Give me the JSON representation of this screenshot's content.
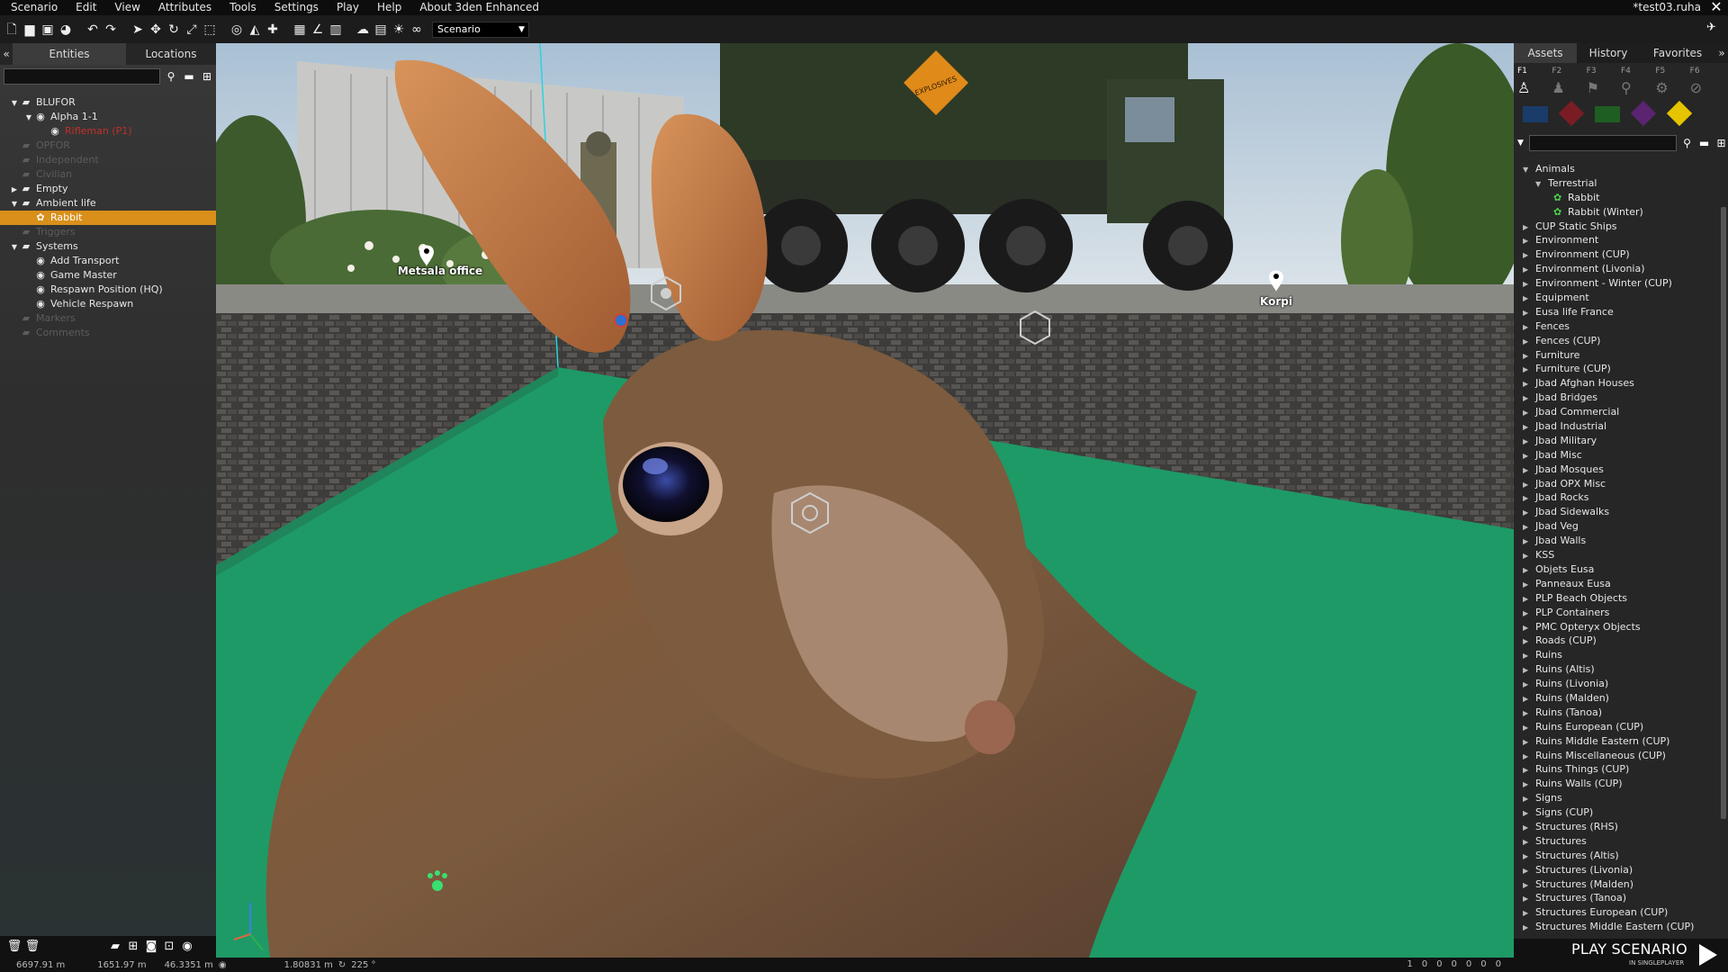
{
  "menubar": {
    "items": [
      "Scenario",
      "Edit",
      "View",
      "Attributes",
      "Tools",
      "Settings",
      "Play",
      "Help",
      "About 3den Enhanced"
    ],
    "file_name": "*test03.ruha"
  },
  "toolbar": {
    "scenario_select": "Scenario"
  },
  "left_panel": {
    "tabs": [
      "Entities",
      "Locations"
    ],
    "search_value": "",
    "tree": [
      {
        "label": "BLUFOR",
        "level": 0,
        "expanded": true,
        "dim": false
      },
      {
        "label": "Alpha 1-1",
        "level": 1,
        "expanded": true,
        "dim": false
      },
      {
        "label": "Rifleman (P1)",
        "level": 2,
        "dim": false,
        "red": true
      },
      {
        "label": "OPFOR",
        "level": 0,
        "dim": true
      },
      {
        "label": "Independent",
        "level": 0,
        "dim": true
      },
      {
        "label": "Civilian",
        "level": 0,
        "dim": true
      },
      {
        "label": "Empty",
        "level": 0,
        "expanded": false,
        "dim": false
      },
      {
        "label": "Ambient life",
        "level": 0,
        "expanded": true,
        "dim": false
      },
      {
        "label": "Rabbit",
        "level": 1,
        "selected": true
      },
      {
        "label": "Triggers",
        "level": 0,
        "dim": true
      },
      {
        "label": "Systems",
        "level": 0,
        "expanded": true,
        "dim": false
      },
      {
        "label": "Add Transport",
        "level": 1,
        "dim": false
      },
      {
        "label": "Game Master",
        "level": 1,
        "dim": false
      },
      {
        "label": "Respawn Position (HQ)",
        "level": 1,
        "dim": false
      },
      {
        "label": "Vehicle Respawn",
        "level": 1,
        "dim": false
      },
      {
        "label": "Markers",
        "level": 0,
        "dim": true
      },
      {
        "label": "Comments",
        "level": 0,
        "dim": true
      }
    ]
  },
  "viewport": {
    "labels": {
      "office": "Metsala office",
      "korpi": "Korpi",
      "crate": "EXPLOSIVES"
    }
  },
  "right_panel": {
    "tabs": [
      "Assets",
      "History",
      "Favorites"
    ],
    "fkeys": [
      "F1",
      "F2",
      "F3",
      "F4",
      "F5",
      "F6"
    ],
    "side_colors": [
      "#1a3c6a",
      "#7a1c24",
      "#1f5e22",
      "#5a2470",
      "#e6c400"
    ],
    "search_value": "",
    "tree": [
      {
        "label": "Animals",
        "level": 0,
        "expanded": true
      },
      {
        "label": "Terrestrial",
        "level": 1,
        "expanded": true
      },
      {
        "label": "Rabbit",
        "level": 2
      },
      {
        "label": "Rabbit (Winter)",
        "level": 2
      },
      {
        "label": "CUP Static Ships",
        "level": 0
      },
      {
        "label": "Environment",
        "level": 0
      },
      {
        "label": "Environment (CUP)",
        "level": 0
      },
      {
        "label": "Environment (Livonia)",
        "level": 0
      },
      {
        "label": "Environment - Winter (CUP)",
        "level": 0
      },
      {
        "label": "Equipment",
        "level": 0
      },
      {
        "label": "Eusa life France",
        "level": 0
      },
      {
        "label": "Fences",
        "level": 0
      },
      {
        "label": "Fences (CUP)",
        "level": 0
      },
      {
        "label": "Furniture",
        "level": 0
      },
      {
        "label": "Furniture (CUP)",
        "level": 0
      },
      {
        "label": "Jbad Afghan Houses",
        "level": 0
      },
      {
        "label": "Jbad Bridges",
        "level": 0
      },
      {
        "label": "Jbad Commercial",
        "level": 0
      },
      {
        "label": "Jbad Industrial",
        "level": 0
      },
      {
        "label": "Jbad Military",
        "level": 0
      },
      {
        "label": "Jbad Misc",
        "level": 0
      },
      {
        "label": "Jbad Mosques",
        "level": 0
      },
      {
        "label": "Jbad OPX Misc",
        "level": 0
      },
      {
        "label": "Jbad Rocks",
        "level": 0
      },
      {
        "label": "Jbad Sidewalks",
        "level": 0
      },
      {
        "label": "Jbad Veg",
        "level": 0
      },
      {
        "label": "Jbad Walls",
        "level": 0
      },
      {
        "label": "KSS",
        "level": 0
      },
      {
        "label": "Objets Eusa",
        "level": 0
      },
      {
        "label": "Panneaux Eusa",
        "level": 0
      },
      {
        "label": "PLP Beach Objects",
        "level": 0
      },
      {
        "label": "PLP Containers",
        "level": 0
      },
      {
        "label": "PMC Opteryx Objects",
        "level": 0
      },
      {
        "label": "Roads (CUP)",
        "level": 0
      },
      {
        "label": "Ruins",
        "level": 0
      },
      {
        "label": "Ruins (Altis)",
        "level": 0
      },
      {
        "label": "Ruins (Livonia)",
        "level": 0
      },
      {
        "label": "Ruins (Malden)",
        "level": 0
      },
      {
        "label": "Ruins (Tanoa)",
        "level": 0
      },
      {
        "label": "Ruins European (CUP)",
        "level": 0
      },
      {
        "label": "Ruins Middle Eastern (CUP)",
        "level": 0
      },
      {
        "label": "Ruins Miscellaneous (CUP)",
        "level": 0
      },
      {
        "label": "Ruins Things (CUP)",
        "level": 0
      },
      {
        "label": "Ruins Walls (CUP)",
        "level": 0
      },
      {
        "label": "Signs",
        "level": 0
      },
      {
        "label": "Signs (CUP)",
        "level": 0
      },
      {
        "label": "Structures (RHS)",
        "level": 0
      },
      {
        "label": "Structures",
        "level": 0
      },
      {
        "label": "Structures (Altis)",
        "level": 0
      },
      {
        "label": "Structures (Livonia)",
        "level": 0
      },
      {
        "label": "Structures (Malden)",
        "level": 0
      },
      {
        "label": "Structures (Tanoa)",
        "level": 0
      },
      {
        "label": "Structures European (CUP)",
        "level": 0
      },
      {
        "label": "Structures Middle Eastern (CUP)",
        "level": 0
      }
    ]
  },
  "play": {
    "label": "PLAY SCENARIO",
    "sub": "IN SINGLEPLAYER"
  },
  "status": {
    "x": "6697.91 m",
    "y": "1651.97 m",
    "z": "46.3351 m",
    "dist": "1.80831 m",
    "angle": "225 °",
    "counts": [
      "1",
      "0",
      "0",
      "0",
      "0",
      "0",
      "0"
    ]
  }
}
